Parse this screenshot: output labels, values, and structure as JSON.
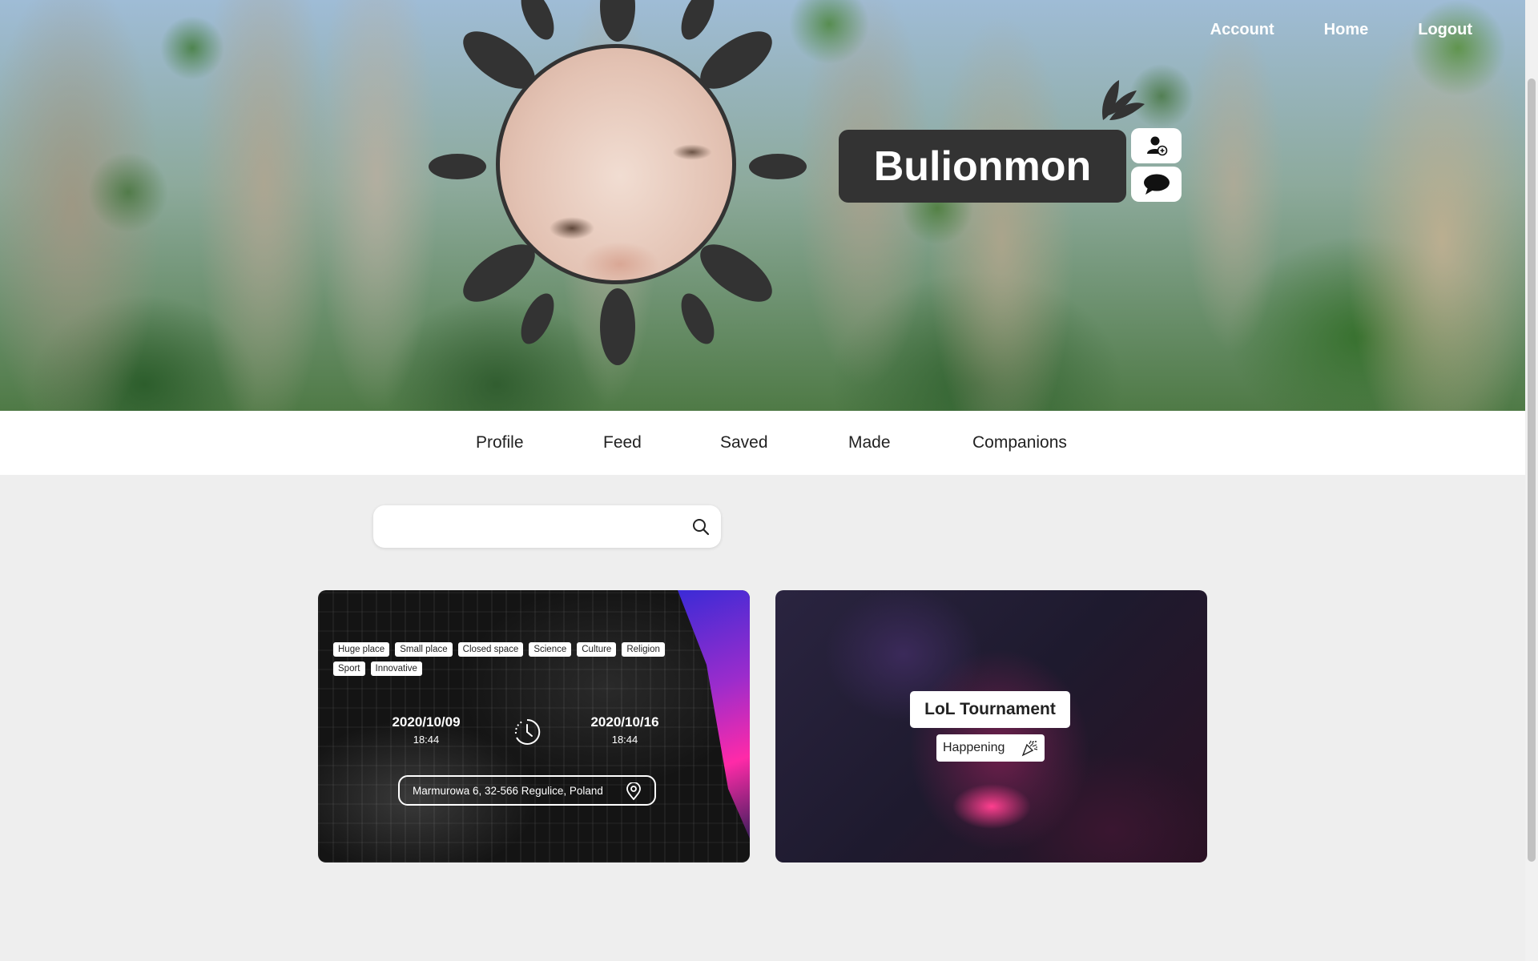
{
  "top_nav": {
    "account": "Account",
    "home": "Home",
    "logout": "Logout"
  },
  "profile": {
    "username": "Bulionmon"
  },
  "tabs": [
    "Profile",
    "Feed",
    "Saved",
    "Made",
    "Companions"
  ],
  "search": {
    "value": "",
    "placeholder": ""
  },
  "cards": [
    {
      "tags": [
        "Huge place",
        "Small place",
        "Closed space",
        "Science",
        "Culture",
        "Religion",
        "Sport",
        "Innovative"
      ],
      "start_date": "2020/10/09",
      "start_time": "18:44",
      "end_date": "2020/10/16",
      "end_time": "18:44",
      "address": "Marmurowa 6, 32-566 Regulice, Poland"
    },
    {
      "title": "LoL Tournament",
      "status": "Happening"
    }
  ],
  "colors": {
    "dark": "#333333",
    "page_bg": "#eeeeee",
    "tabs_bg": "#ffffff"
  }
}
